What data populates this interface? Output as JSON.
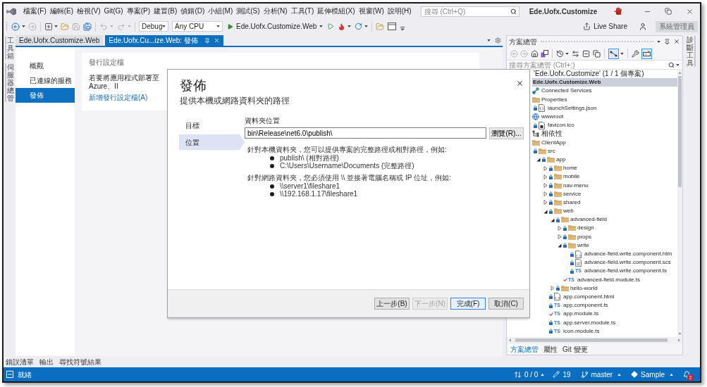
{
  "menu_bar": {
    "items": [
      "檔案(F)",
      "編輯(E)",
      "檢視(V)",
      "Git(G)",
      "專案(P)",
      "建置(B)",
      "偵錯(D)",
      "小組(M)",
      "測試(S)",
      "分析(N)",
      "工具(T)",
      "延伸模組(X)",
      "視窗(W)",
      "說明(H)"
    ],
    "search": {
      "placeholder": "搜尋 (Ctrl+Q)"
    },
    "title": "Ede.Uofx.Customize"
  },
  "toolbar": {
    "configuration": "Debug",
    "platform": "Any CPU",
    "startup_project": "Ede.Uofx.Customize.Web",
    "live_share": "Live Share",
    "account": "系統管理員"
  },
  "left_strip": [
    "工具箱",
    "伺服器總管"
  ],
  "right_strip": [
    "診斷工具"
  ],
  "document_tabs": [
    {
      "label": "Ede.Uofx.Customize.Web",
      "selected": false
    },
    {
      "label": "Ede.Uofx.Cu...ize.Web: 發佈",
      "selected": true
    }
  ],
  "publish_page": {
    "nav": [
      {
        "label": "概觀",
        "selected": false
      },
      {
        "label": "已連線的服務",
        "selected": false
      },
      {
        "label": "發佈",
        "selected": true
      }
    ],
    "card": {
      "title": "發行設定檔",
      "text": "若要將應用程式部署至 Azure、II",
      "link": "新增發行設定檔(A)"
    }
  },
  "dialog": {
    "title": "發佈",
    "subtitle": "提供本機或網路資料夾的路徑",
    "steps": [
      {
        "label": "目標",
        "selected": false
      },
      {
        "label": "位置",
        "selected": true
      }
    ],
    "folder_label": "資料夾位置",
    "folder_value": "bin\\Release\\net6.0\\publish\\",
    "browse_button": "瀏覽(R)...",
    "help": [
      {
        "text": "針對本機資料夾，您可以提供專案的完整路徑或相對路徑，例如:",
        "examples": [
          "publish\\ (相對路徑)",
          "C:\\Users\\Username\\Documents (完整路徑)"
        ]
      },
      {
        "text": "針對網路資料夾，您必須使用 \\\\ 並接著電腦名稱或 IP 位址，例如:",
        "examples": [
          "\\\\server1\\fileshare1",
          "\\\\192.168.1.17\\fileshare1"
        ]
      }
    ],
    "buttons": [
      {
        "label": "上一步(B)",
        "disabled": false,
        "default": false
      },
      {
        "label": "下一步(N)",
        "disabled": true,
        "default": false
      },
      {
        "label": "完成(F)",
        "disabled": false,
        "default": true
      },
      {
        "label": "取消(C)",
        "disabled": false,
        "default": false
      }
    ]
  },
  "solution_explorer": {
    "title": "方案總管",
    "toolbar": {
      "filter_on": true,
      "preview_on": true
    },
    "search": {
      "placeholder": "搜尋方案總管 (Ctrl+;)"
    },
    "tree": [
      {
        "label": "'Ede.Uofx.Customize' (1 / 1 個專案)",
        "kind": "solution",
        "selected": false,
        "children": [
          {
            "label": "Ede.Uofx.Customize.Web",
            "kind": "project",
            "selected": true,
            "children": [
              {
                "label": "Connected Services",
                "kind": "connected",
                "selected": false
              },
              {
                "label": "Properties",
                "kind": "folder",
                "selected": false,
                "children": [
                  {
                    "label": "launchSettings.json",
                    "kind": "json",
                    "checked_out": false,
                    "selected": false
                  }
                ]
              },
              {
                "label": "wwwroot",
                "kind": "globe",
                "selected": false,
                "children": [
                  {
                    "label": "favicon.ico",
                    "kind": "image",
                    "checked_out": false,
                    "selected": false
                  }
                ]
              },
              {
                "label": "相依性",
                "kind": "dependencies",
                "selected": false
              },
              {
                "label": "ClientApp",
                "kind": "folder",
                "selected": false,
                "children": [
                  {
                    "label": "src",
                    "kind": "folder",
                    "checked_out": false,
                    "selected": false,
                    "children": [
                      {
                        "label": "app",
                        "kind": "folder",
                        "checked_out": false,
                        "expanded": true,
                        "selected": false,
                        "children": [
                          {
                            "label": "home",
                            "kind": "folder",
                            "checked_out": false,
                            "expanded": false,
                            "selected": false
                          },
                          {
                            "label": "mobile",
                            "kind": "folder",
                            "checked_out": false,
                            "expanded": false,
                            "selected": false
                          },
                          {
                            "label": "nav-menu",
                            "kind": "folder",
                            "checked_out": false,
                            "expanded": false,
                            "selected": false
                          },
                          {
                            "label": "service",
                            "kind": "folder",
                            "checked_out": false,
                            "expanded": false,
                            "selected": false
                          },
                          {
                            "label": "shared",
                            "kind": "folder",
                            "checked_out": false,
                            "expanded": false,
                            "selected": false
                          },
                          {
                            "label": "web",
                            "kind": "folder",
                            "checked_out": false,
                            "expanded": true,
                            "selected": false,
                            "children": [
                              {
                                "label": "advanced-field",
                                "kind": "folder",
                                "checked_out": false,
                                "expanded": true,
                                "selected": false,
                                "children": [
                                  {
                                    "label": "design",
                                    "kind": "folder",
                                    "checked_out": false,
                                    "expanded": false,
                                    "selected": false
                                  },
                                  {
                                    "label": "props",
                                    "kind": "folder",
                                    "checked_out": false,
                                    "expanded": false,
                                    "selected": false
                                  },
                                  {
                                    "label": "write",
                                    "kind": "folder",
                                    "checked_out": false,
                                    "expanded": true,
                                    "selected": false,
                                    "children": [
                                      {
                                        "label": "advance-field.write.component.htm",
                                        "kind": "html",
                                        "checked_out": false,
                                        "selected": false
                                      },
                                      {
                                        "label": "advance-field.write.component.scs",
                                        "kind": "scss",
                                        "checked_out": false,
                                        "selected": false
                                      },
                                      {
                                        "label": "advance-field.write.component.ts",
                                        "kind": "ts",
                                        "icon_text": "TS",
                                        "checked_out": false,
                                        "selected": false
                                      }
                                    ]
                                  },
                                  {
                                    "label": "advanced-field.module.ts",
                                    "kind": "ts",
                                    "icon_text": "TS",
                                    "checked_out": true,
                                    "selected": false
                                  }
                                ]
                              },
                              {
                                "label": "hello-world",
                                "kind": "folder",
                                "checked_out": false,
                                "expanded": false,
                                "selected": false
                              }
                            ]
                          },
                          {
                            "label": "app.component.html",
                            "kind": "html",
                            "checked_out": false,
                            "selected": false
                          },
                          {
                            "label": "app.component.ts",
                            "kind": "ts",
                            "icon_text": "TS",
                            "checked_out": false,
                            "selected": false
                          },
                          {
                            "label": "app.module.ts",
                            "kind": "ts",
                            "icon_text": "TS",
                            "checked_out": true,
                            "selected": false
                          },
                          {
                            "label": "app.server.module.ts",
                            "kind": "ts",
                            "icon_text": "TS",
                            "checked_out": false,
                            "selected": false
                          },
                          {
                            "label": "icon.module.ts",
                            "kind": "ts",
                            "icon_text": "TS",
                            "checked_out": false,
                            "selected": false
                          }
                        ]
                      }
                    ]
                  }
                ]
              }
            ]
          }
        ]
      }
    ],
    "tabs": [
      {
        "label": "方案總管",
        "selected": true
      },
      {
        "label": "屬性",
        "selected": false
      },
      {
        "label": "Git 變更",
        "selected": false
      }
    ]
  },
  "bottom_tabs": [
    "錯誤清單",
    "輸出",
    "尋找符號結果"
  ],
  "status_bar": {
    "status": "就緒",
    "sync": "0 / 0",
    "changes": "19",
    "branch": "master",
    "repository": "Sample",
    "notifications": "2"
  }
}
